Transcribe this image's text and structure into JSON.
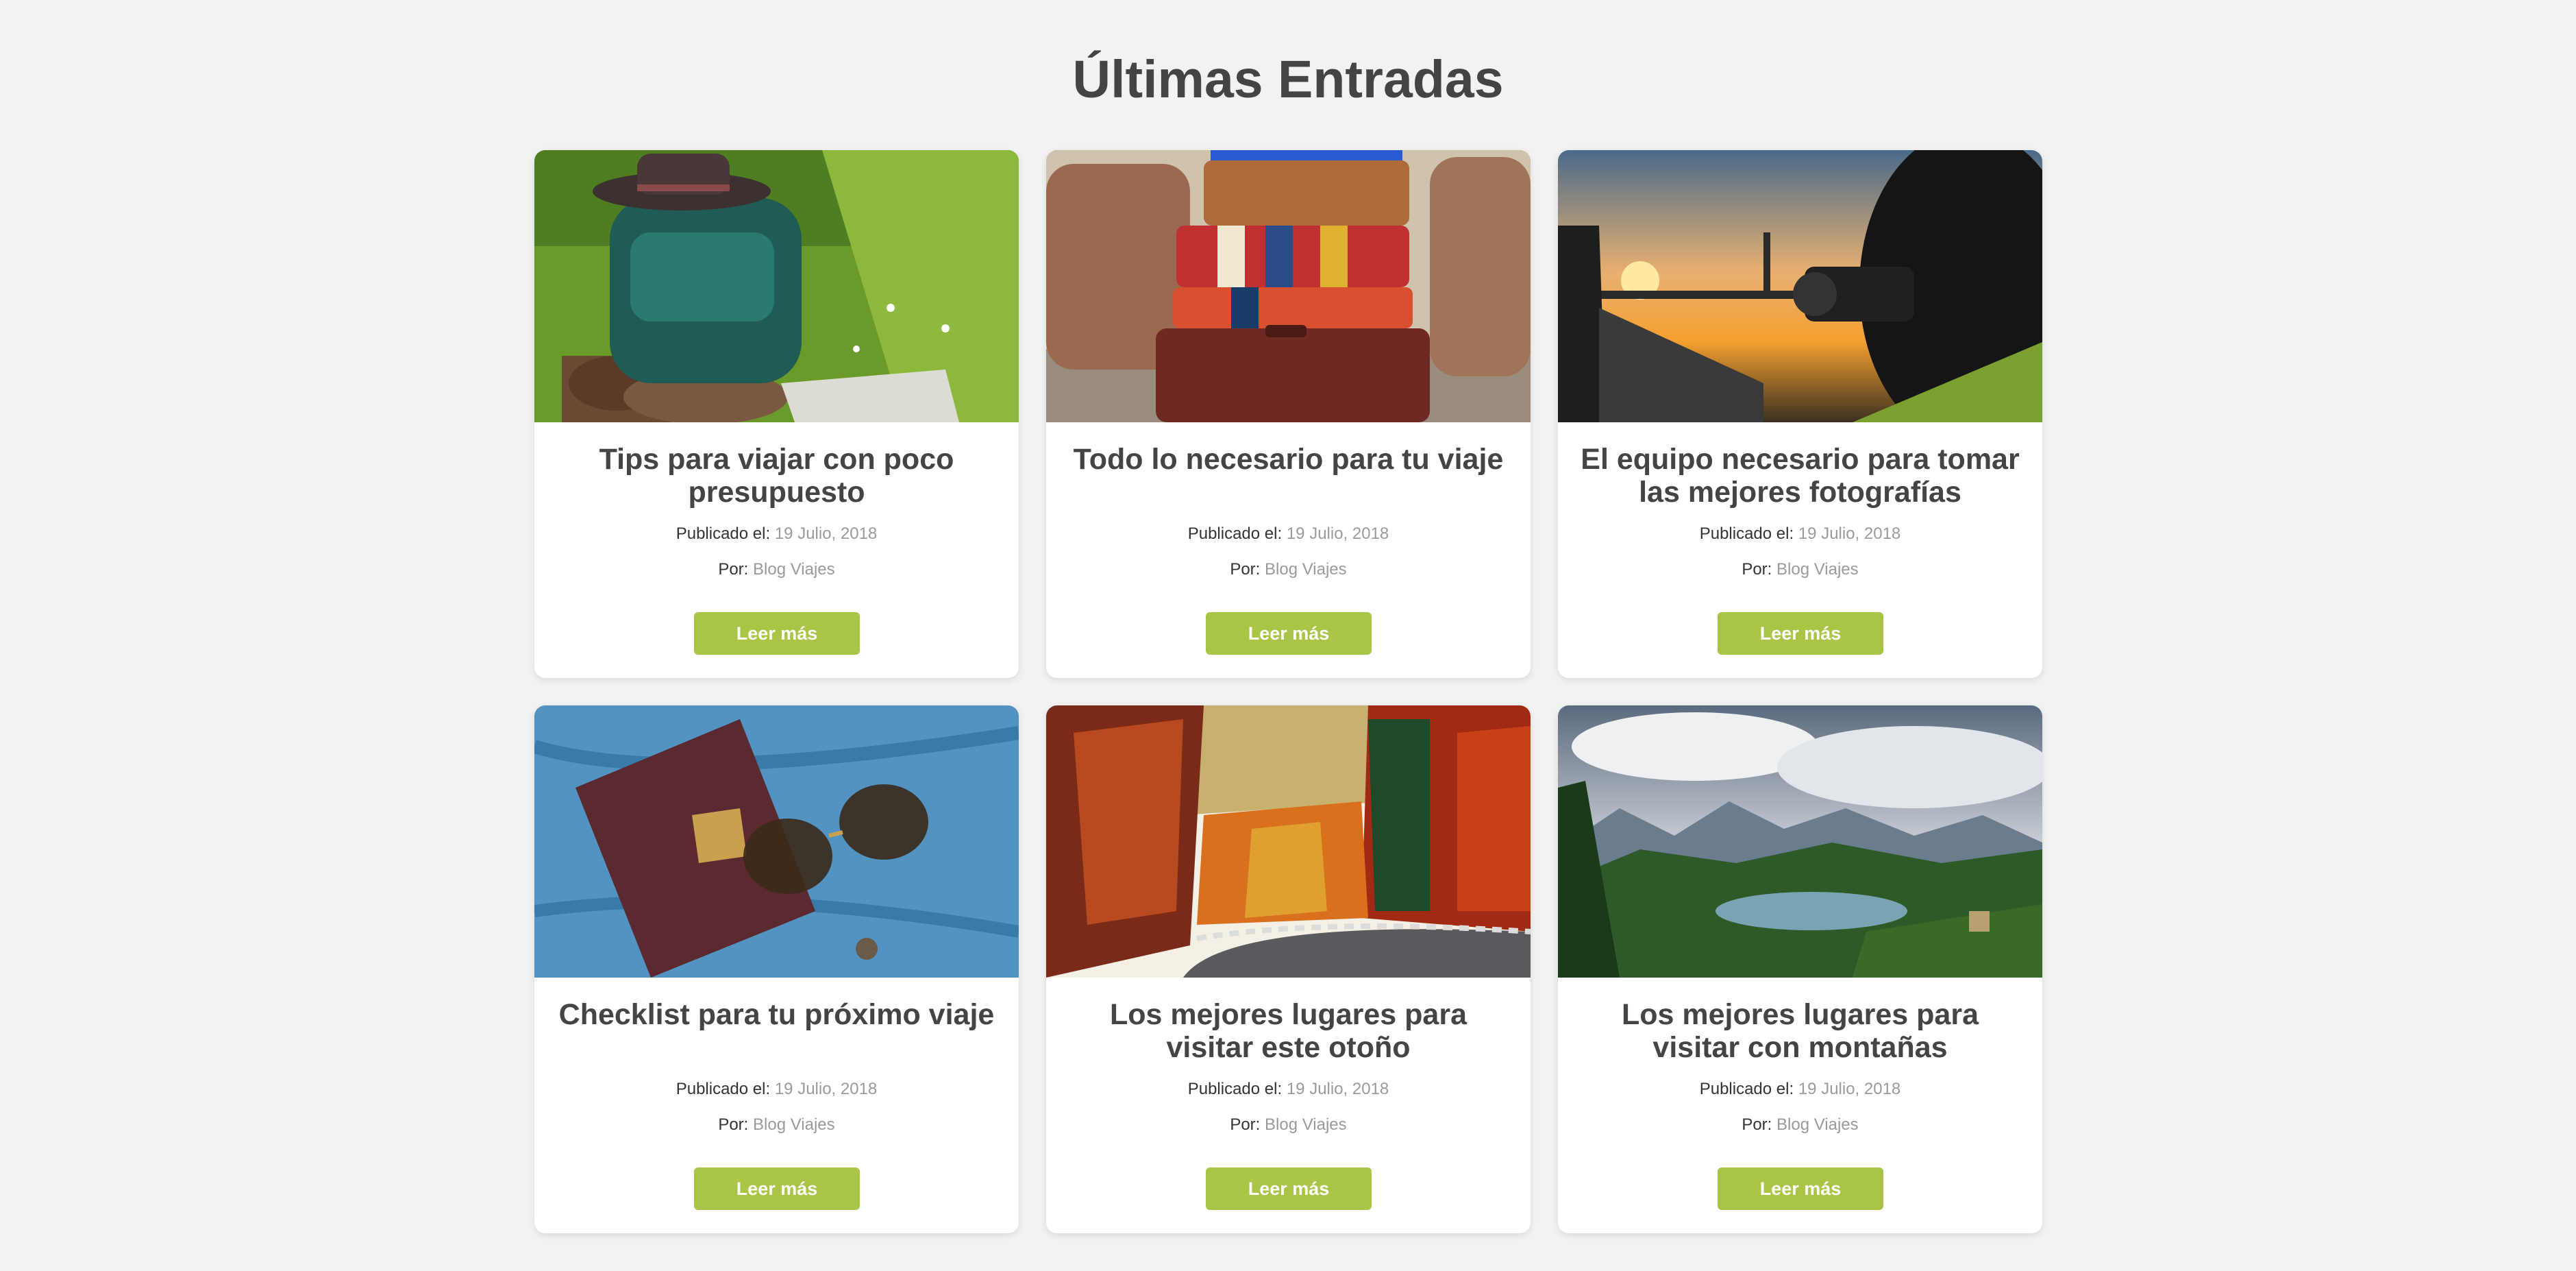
{
  "page": {
    "title": "Últimas Entradas"
  },
  "labels": {
    "published": "Publicado el:",
    "author": "Por:"
  },
  "posts": [
    {
      "title": "Tips para viajar con poco presupuesto",
      "date": "19 Julio, 2018",
      "author": "Blog Viajes",
      "button": "Leer más",
      "image": "backpack-hiking-gear-photo"
    },
    {
      "title": "Todo lo necesario para tu viaje",
      "date": "19 Julio, 2018",
      "author": "Blog Viajes",
      "button": "Leer más",
      "image": "stacked-suitcases-photo"
    },
    {
      "title": "El equipo necesario para tomar las mejores fotografías",
      "date": "19 Julio, 2018",
      "author": "Blog Viajes",
      "button": "Leer más",
      "image": "photographer-sunset-photo"
    },
    {
      "title": "Checklist para tu próximo viaje",
      "date": "19 Julio, 2018",
      "author": "Blog Viajes",
      "button": "Leer más",
      "image": "passport-sunglasses-photo"
    },
    {
      "title": "Los mejores lugares para visitar este otoño",
      "date": "19 Julio, 2018",
      "author": "Blog Viajes",
      "button": "Leer más",
      "image": "autumn-forest-road-photo"
    },
    {
      "title": "Los mejores lugares para visitar con montañas",
      "date": "19 Julio, 2018",
      "author": "Blog Viajes",
      "button": "Leer más",
      "image": "mountain-lake-photo"
    }
  ],
  "colors": {
    "accent": "#a8c545",
    "background": "#f2f2f2",
    "title": "#444444",
    "muted": "#9a9a9a"
  }
}
